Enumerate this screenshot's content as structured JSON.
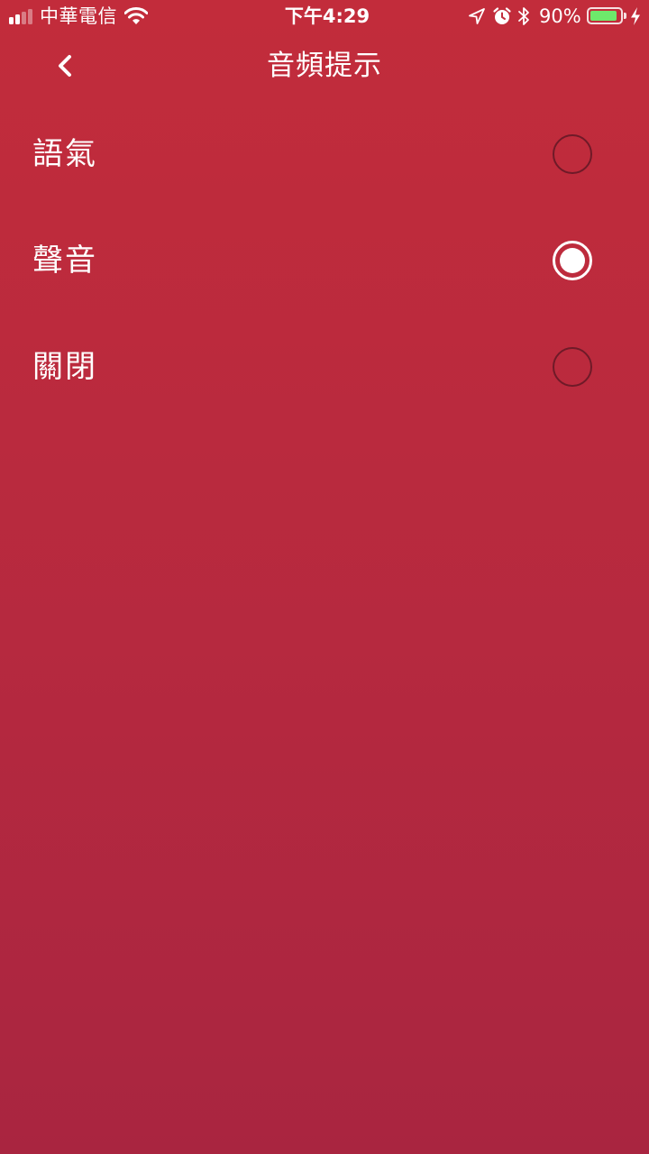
{
  "status_bar": {
    "carrier": "中華電信",
    "time": "下午4:29",
    "battery_percent": "90%",
    "battery_level": 0.9,
    "signal_bars_active": 2,
    "signal_bars_total": 4,
    "icons": [
      "signal-icon",
      "wifi-icon",
      "location-icon",
      "alarm-icon",
      "bluetooth-icon",
      "battery-icon",
      "charging-icon"
    ],
    "battery_color": "#6ee96b"
  },
  "nav": {
    "title": "音頻提示",
    "back_icon": "chevron-left-icon"
  },
  "options": [
    {
      "label": "語氣",
      "selected": false
    },
    {
      "label": "聲音",
      "selected": true
    },
    {
      "label": "關閉",
      "selected": false
    }
  ],
  "colors": {
    "background_top": "#c22c3b",
    "background_bottom": "#a92540",
    "radio_unselected_border": "#6f1a28",
    "radio_selected": "#ffffff"
  }
}
